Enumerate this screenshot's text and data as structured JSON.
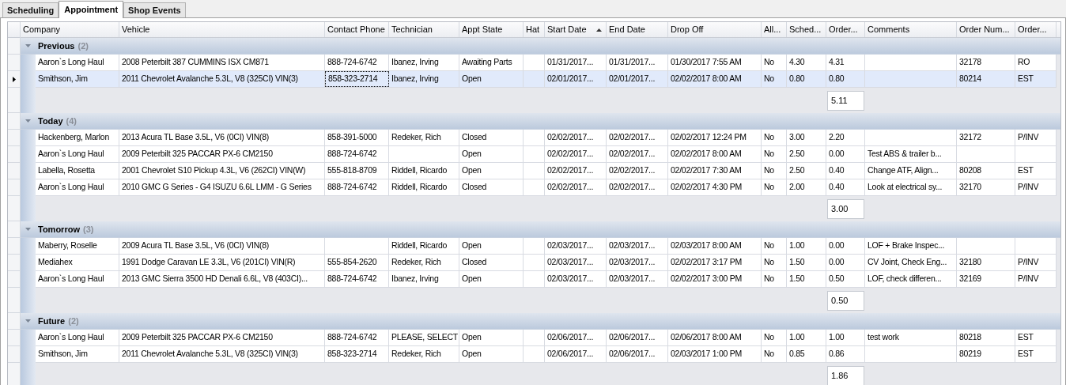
{
  "tabs": [
    {
      "label": "Scheduling",
      "selected": false
    },
    {
      "label": "Appointment",
      "selected": true
    },
    {
      "label": "Shop Events",
      "selected": false
    }
  ],
  "table": {
    "columns": [
      {
        "label": "Company",
        "sorted": false
      },
      {
        "label": "Vehicle",
        "sorted": false
      },
      {
        "label": "Contact Phone",
        "sorted": false
      },
      {
        "label": "Technician",
        "sorted": false
      },
      {
        "label": "Appt State",
        "sorted": false
      },
      {
        "label": "Hat",
        "sorted": false
      },
      {
        "label": "Start Date",
        "sorted": true
      },
      {
        "label": "End Date",
        "sorted": false
      },
      {
        "label": "Drop Off",
        "sorted": false
      },
      {
        "label": "All...",
        "sorted": false
      },
      {
        "label": "Sched...",
        "sorted": false
      },
      {
        "label": "Order...",
        "sorted": false
      },
      {
        "label": "Comments",
        "sorted": false
      },
      {
        "label": "Order Num...",
        "sorted": false
      },
      {
        "label": "Order...",
        "sorted": false
      }
    ],
    "groups": [
      {
        "name": "Previous",
        "count": "(2)",
        "expanded": true,
        "summary": "5.11",
        "rows": [
          {
            "selected": false,
            "cells": [
              "Aaron`s Long Haul",
              "2008 Peterbilt 387 CUMMINS ISX CM871",
              "888-724-6742",
              "Ibanez, Irving",
              "Awaiting Parts",
              null,
              "01/31/2017...",
              "01/31/2017...",
              "01/30/2017 7:55 AM",
              "No",
              "4.30",
              "4.31",
              null,
              "32178",
              "RO"
            ]
          },
          {
            "selected": true,
            "cells": [
              "Smithson, Jim",
              "2011 Chevrolet Avalanche 5.3L, V8 (325CI) VIN(3)",
              {
                "text": "858-323-2714",
                "focused": true
              },
              "Ibanez, Irving",
              "Open",
              null,
              "02/01/2017...",
              "02/01/2017...",
              "02/02/2017 8:00 AM",
              "No",
              "0.80",
              "0.80",
              null,
              "80214",
              "EST"
            ]
          }
        ]
      },
      {
        "name": "Today",
        "count": "(4)",
        "expanded": true,
        "summary": "3.00",
        "rows": [
          {
            "selected": false,
            "cells": [
              "Hackenberg, Marlon",
              "2013 Acura TL Base 3.5L, V6 (0CI) VIN(8)",
              "858-391-5000",
              "Redeker, Rich",
              "Closed",
              null,
              "02/02/2017...",
              "02/02/2017...",
              "02/02/2017 12:24 PM",
              "No",
              "3.00",
              "2.20",
              null,
              "32172",
              "P/INV"
            ]
          },
          {
            "selected": false,
            "cells": [
              "Aaron`s Long Haul",
              "2009 Peterbilt 325 PACCAR PX-6 CM2150",
              "888-724-6742",
              null,
              "Open",
              null,
              "02/02/2017...",
              "02/02/2017...",
              "02/02/2017 8:00 AM",
              "No",
              "2.50",
              "0.00",
              "Test ABS & trailer b...",
              null,
              null
            ]
          },
          {
            "selected": false,
            "cells": [
              "Labella, Rosetta",
              "2001 Chevrolet S10 Pickup 4.3L, V6 (262CI) VIN(W)",
              "555-818-8709",
              "Riddell, Ricardo",
              "Open",
              null,
              "02/02/2017...",
              "02/02/2017...",
              "02/02/2017 7:30 AM",
              "No",
              "2.50",
              "0.40",
              "Change ATF, Align...",
              "80208",
              "EST"
            ]
          },
          {
            "selected": false,
            "cells": [
              "Aaron`s Long Haul",
              "2010 GMC G Series - G4 ISUZU 6.6L LMM - G Series",
              "888-724-6742",
              "Riddell, Ricardo",
              "Closed",
              null,
              "02/02/2017...",
              "02/02/2017...",
              "02/02/2017 4:30 PM",
              "No",
              "2.00",
              "0.40",
              "Look at electrical sy...",
              "32170",
              "P/INV"
            ]
          }
        ]
      },
      {
        "name": "Tomorrow",
        "count": "(3)",
        "expanded": true,
        "summary": "0.50",
        "rows": [
          {
            "selected": false,
            "cells": [
              "Maberry, Roselle",
              "2009 Acura TL Base 3.5L, V6 (0CI) VIN(8)",
              null,
              "Riddell, Ricardo",
              "Open",
              null,
              "02/03/2017...",
              "02/03/2017...",
              "02/03/2017 8:00 AM",
              "No",
              "1.00",
              "0.00",
              "LOF + Brake Inspec...",
              null,
              null
            ]
          },
          {
            "selected": false,
            "cells": [
              "Mediahex",
              "1991 Dodge Caravan LE 3.3L, V6 (201CI) VIN(R)",
              "555-854-2620",
              "Redeker, Rich",
              "Closed",
              null,
              "02/03/2017...",
              "02/03/2017...",
              "02/02/2017 3:17 PM",
              "No",
              "1.50",
              "0.00",
              "CV Joint, Check Eng...",
              "32180",
              "P/INV"
            ]
          },
          {
            "selected": false,
            "cells": [
              "Aaron`s Long Haul",
              "2013 GMC Sierra 3500 HD Denali 6.6L, V8 (403CI)...",
              "888-724-6742",
              "Ibanez, Irving",
              "Open",
              null,
              "02/03/2017...",
              "02/03/2017...",
              "02/02/2017 3:00 PM",
              "No",
              "1.50",
              "0.50",
              "LOF, check differen...",
              "32169",
              "P/INV"
            ]
          }
        ]
      },
      {
        "name": "Future",
        "count": "(2)",
        "expanded": true,
        "summary": "1.86",
        "rows": [
          {
            "selected": false,
            "cells": [
              "Aaron`s Long Haul",
              "2009 Peterbilt 325 PACCAR PX-6 CM2150",
              "888-724-6742",
              "PLEASE, SELECT",
              "Open",
              null,
              "02/06/2017...",
              "02/06/2017...",
              "02/06/2017 8:00 AM",
              "No",
              "1.00",
              "1.00",
              "test work",
              "80218",
              "EST"
            ]
          },
          {
            "selected": false,
            "cells": [
              "Smithson, Jim",
              "2011 Chevrolet Avalanche 5.3L, V8 (325CI) VIN(3)",
              "858-323-2714",
              "Redeker, Rich",
              "Open",
              null,
              "02/06/2017...",
              "02/06/2017...",
              "02/03/2017 1:00 PM",
              "No",
              "0.85",
              "0.86",
              null,
              "80219",
              "EST"
            ]
          }
        ]
      }
    ]
  }
}
